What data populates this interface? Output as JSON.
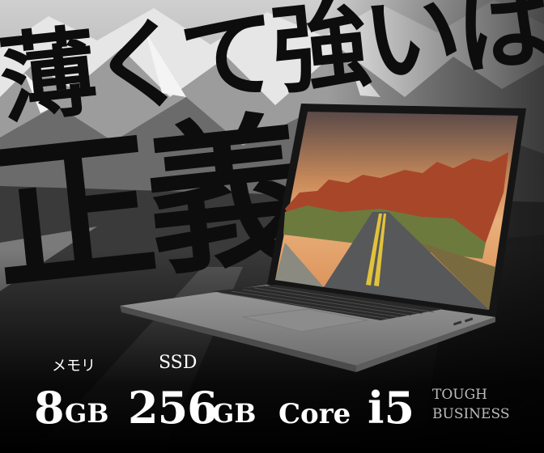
{
  "headline": {
    "line1": "薄くて強いは",
    "line2": "正義"
  },
  "specs": {
    "memory_label": "メモリ",
    "memory_value": "8",
    "memory_unit": "GB",
    "storage_label": "SSD",
    "storage_value": "256",
    "storage_unit": "GB",
    "cpu_name": "Core",
    "cpu_model": "i5"
  },
  "tagline": {
    "line1": "TOUGH",
    "line2": "BUSINESS"
  },
  "colors": {
    "headline": "#0d0d0d",
    "spec_text": "#ffffff",
    "tagline": "#bdbdbd",
    "laptop_body": "#8a8a8a"
  }
}
